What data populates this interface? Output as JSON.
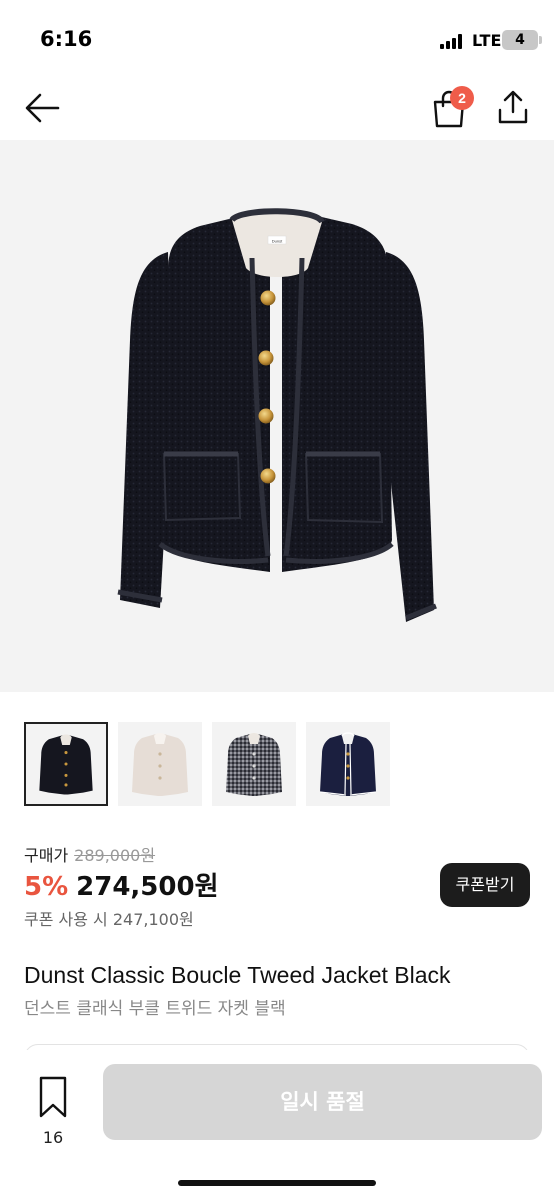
{
  "status_bar": {
    "time": "6:16",
    "network": "LTE",
    "battery": "4"
  },
  "header": {
    "back_icon": "arrow-left-icon",
    "cart_icon": "shopping-bag-icon",
    "cart_badge": "2",
    "share_icon": "share-icon"
  },
  "product": {
    "thumbnails": [
      {
        "variant": "black tweed",
        "selected": true
      },
      {
        "variant": "ivory tweed",
        "selected": false
      },
      {
        "variant": "gray check tweed",
        "selected": false
      },
      {
        "variant": "navy tweed with white trim",
        "selected": false
      }
    ],
    "price_label": "구매가",
    "original_price": "289,000원",
    "discount": "5%",
    "sale_price": "274,500원",
    "coupon_button": "쿠폰받기",
    "coupon_price_text": "쿠폰 사용 시 247,100원",
    "title_en": "Dunst Classic Boucle Tweed Jacket Black",
    "title_ko": "던스트 클래식 부클 트위드 자켓 블랙",
    "label_tag": "Dunst"
  },
  "bottom_bar": {
    "bookmark_icon": "bookmark-icon",
    "bookmark_count": "16",
    "action_label": "일시 품절"
  },
  "colors": {
    "accent_discount": "#e9553f",
    "badge": "#ef5c4a",
    "soldout_bg": "#d6d6d6",
    "coupon_bg": "#1c1c1c"
  }
}
